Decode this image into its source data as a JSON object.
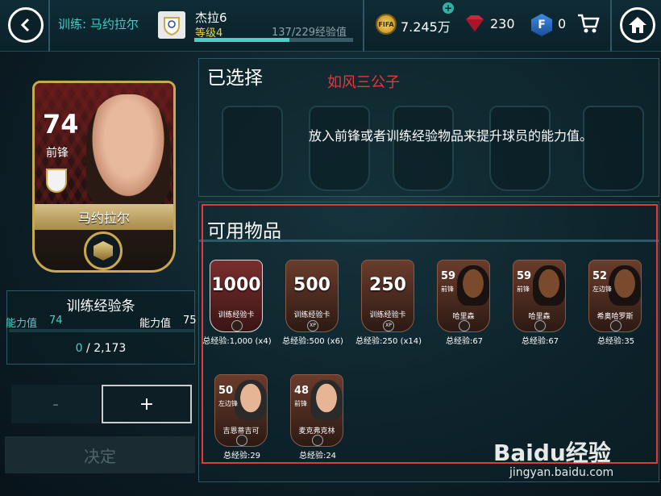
{
  "topbar": {
    "title": "训练: 马约拉尔",
    "player_name": "杰拉6",
    "level_label": "等级4",
    "level_progress": 0.6,
    "xp_text": "137/229经验值",
    "coins": "7.245万",
    "coin_icon_text": "FIFA",
    "gems": "230",
    "fifa_points": "0",
    "fp_icon_text": "F"
  },
  "player_card": {
    "rating": "74",
    "position": "前锋",
    "name": "马约拉尔"
  },
  "training_bar": {
    "title": "训练经验条",
    "ability_label": "能力值",
    "ability_current": "74",
    "ability_target": "75",
    "xp_current": "0",
    "xp_separator": " / ",
    "xp_total": "2,173"
  },
  "buttons": {
    "minus": "-",
    "plus": "+",
    "confirm": "决定"
  },
  "selected": {
    "title": "已选择",
    "hint": "放入前锋或者训练经验物品来提升球员的能力值。"
  },
  "watermark_text": "如风三公子",
  "available": {
    "title": "可用物品",
    "items": [
      {
        "type": "training",
        "value": "1000",
        "label": "训练经验卡",
        "total": "总经验:1,000 (x4)"
      },
      {
        "type": "training",
        "value": "500",
        "label": "训练经验卡",
        "xp": "XP",
        "total": "总经验:500 (x6)"
      },
      {
        "type": "training",
        "value": "250",
        "label": "训练经验卡",
        "xp": "XP",
        "total": "总经验:250 (x14)"
      },
      {
        "type": "player",
        "rating": "59",
        "position": "前锋",
        "name": "哈里森",
        "total": "总经验:67"
      },
      {
        "type": "player",
        "rating": "59",
        "position": "前锋",
        "name": "哈里森",
        "total": "总经验:67"
      },
      {
        "type": "player",
        "rating": "52",
        "position": "左边锋",
        "name": "希奥哈罗斯",
        "total": "总经验:35"
      },
      {
        "type": "player",
        "rating": "50",
        "position": "左边锋",
        "name": "吉恩蒂吉可",
        "total": "总经验:29"
      },
      {
        "type": "player",
        "rating": "48",
        "position": "前锋",
        "name": "麦克弗克林",
        "total": "总经验:24"
      }
    ]
  },
  "site_watermark": {
    "brand": "Baidu经验",
    "url": "jingyan.baidu.com"
  }
}
